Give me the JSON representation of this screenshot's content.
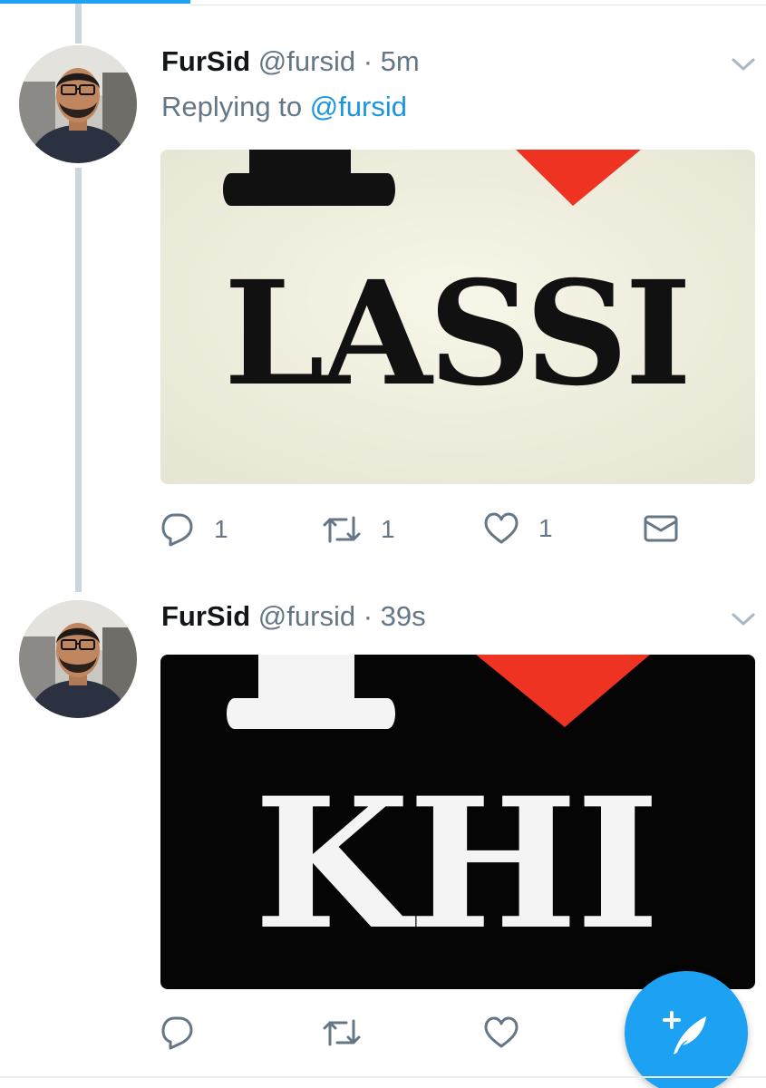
{
  "tweets": [
    {
      "name": "FurSid",
      "handle": "@fursid",
      "separator": "·",
      "time": "5m",
      "reply_prefix": "Replying to",
      "reply_mention": "@fursid",
      "media_text": "LASSI",
      "reply_count": "1",
      "retweet_count": "1",
      "like_count": "1"
    },
    {
      "name": "FurSid",
      "handle": "@fursid",
      "separator": "·",
      "time": "39s",
      "media_text": "KHI"
    }
  ],
  "icons": {
    "reply": "reply-icon",
    "retweet": "retweet-icon",
    "like": "heart-icon",
    "dm": "envelope-icon",
    "menu": "chevron-down-icon",
    "compose": "compose-tweet-icon"
  },
  "colors": {
    "brand": "#1da1f2",
    "link": "#1b95e0",
    "muted": "#657786",
    "thread_line": "#ccd6dd",
    "heart_red": "#ee3322"
  }
}
